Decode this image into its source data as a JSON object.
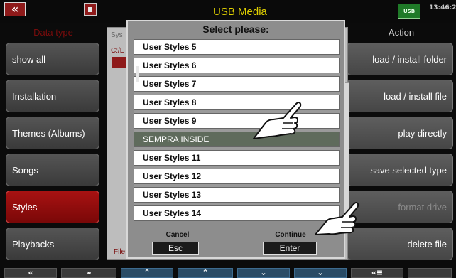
{
  "topbar": {
    "title": "USB Media",
    "back_icon": "«",
    "usb_icon_label": "USB",
    "time": "13:46:2"
  },
  "left_panel": {
    "header": "Data type",
    "buttons": [
      "show all",
      "Installation",
      "Themes (Albums)",
      "Songs",
      "Styles",
      "Playbacks"
    ],
    "active": "Styles"
  },
  "right_panel": {
    "header": "Action",
    "buttons": [
      "load / install folder",
      "load / install file",
      "play directly",
      "save selected type",
      "format drive",
      "delete file"
    ],
    "disabled": "format drive"
  },
  "background": {
    "sys_label": "Sys",
    "path": "C:/E",
    "file_label": "File"
  },
  "dialog": {
    "title": "Select please:",
    "items": [
      "User Styles 5",
      "User Styles 6",
      "User Styles 7",
      "User Styles 8",
      "User Styles 9",
      "SEMPRA INSIDE",
      "User Styles 11",
      "User Styles 12",
      "User Styles 13",
      "User Styles 14"
    ],
    "highlighted": "SEMPRA INSIDE",
    "cancel_label": "Cancel",
    "cancel_button": "Esc",
    "continue_label": "Continue",
    "continue_button": "Enter"
  },
  "bottom_nav": [
    "«",
    "»",
    "⌃",
    "⌃",
    "⌄",
    "⌄",
    "«≡",
    ""
  ],
  "colors": {
    "accent_red": "#8e1a1a",
    "title_yellow": "#e0d000",
    "usb_green": "#1f7a28"
  }
}
